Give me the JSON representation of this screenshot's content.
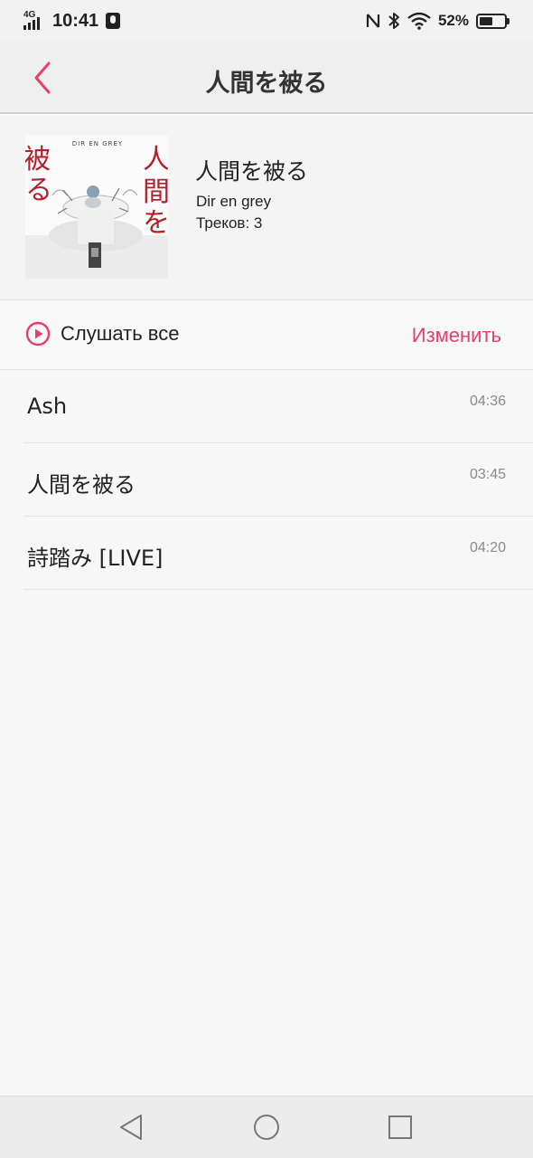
{
  "status_bar": {
    "network": "4G",
    "time": "10:41",
    "battery_percent": "52%",
    "battery_level": 0.52,
    "icons": [
      "signal-icon",
      "mic-icon",
      "nfc-icon",
      "bluetooth-icon",
      "wifi-icon",
      "battery-icon"
    ]
  },
  "header": {
    "title": "人間を被る",
    "back_icon": "chevron-left-icon"
  },
  "album": {
    "title": "人間を被る",
    "artist": "Dir en grey",
    "tracks_label": "Треков: 3",
    "cover": {
      "band_text": "DIR EN GREY",
      "left_text": "被る",
      "right_text": "人間を"
    }
  },
  "actions": {
    "play_all_label": "Слушать все",
    "edit_label": "Изменить"
  },
  "tracks": [
    {
      "title": "Ash",
      "duration": "04:36"
    },
    {
      "title": "人間を被る",
      "duration": "03:45"
    },
    {
      "title": "詩踏み [LIVE]",
      "duration": "04:20"
    }
  ],
  "colors": {
    "accent": "#e5406b",
    "cover_red": "#b3202b"
  },
  "nav_bar": {
    "icons": [
      "back-triangle-icon",
      "home-circle-icon",
      "recents-square-icon"
    ]
  }
}
